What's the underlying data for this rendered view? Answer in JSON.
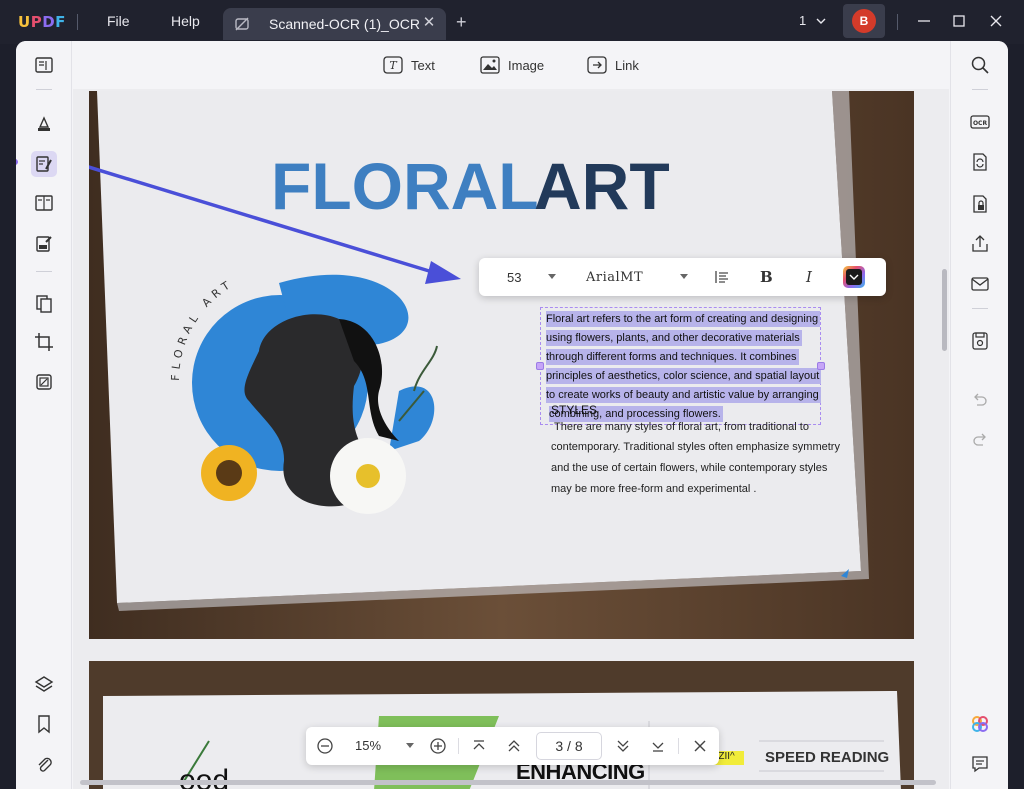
{
  "titlebar": {
    "logo": "UPDF",
    "menu_file": "File",
    "menu_help": "Help",
    "tab_title": "Scanned-OCR (1)_OCR",
    "tab_close": "✕",
    "tab_add": "+",
    "page_count": "1",
    "avatar_letter": "B"
  },
  "edit_toolbar": {
    "text_label": "Text",
    "image_label": "Image",
    "link_label": "Link"
  },
  "format_bar": {
    "font_size": "53",
    "font_name": "ArialMT",
    "bold": "B",
    "italic": "I",
    "color": "#1a1a1a"
  },
  "document": {
    "page1": {
      "heading_light": "FLORAL",
      "heading_dark": "ART",
      "circle_text": "FLORAL ART",
      "selected_lines": [
        "Floral art refers to the art form of creating and designing",
        "using flowers, plants, and other decorative materials",
        "through different forms and techniques. It combines",
        "principles of aesthetics, color science, and spatial layout",
        "to create works of beauty and artistic value by arranging",
        "combining, and processing flowers."
      ],
      "styles_title": "STYLES",
      "styles_lines": [
        "There are many styles of floral art, from traditional to",
        "contemporary. Traditional styles often emphasize symmetry",
        "and the use of certain flowers, while contemporary styles",
        "may be more free-form and experimental  ."
      ]
    },
    "page2": {
      "partial_heading": "ENHANCING",
      "speed_reading": "SPEED READING",
      "highlight_text": "FIIOIIII ZII^",
      "partial_word": "ood"
    }
  },
  "navigation": {
    "zoom": "15%",
    "page_indicator": "3 / 8"
  },
  "colors": {
    "accent": "#8b6cf0",
    "titlebar": "#20222e",
    "selection": "#b7b3ea",
    "floral_blue": "#2f86d6",
    "arrow": "#4a4fd8"
  }
}
